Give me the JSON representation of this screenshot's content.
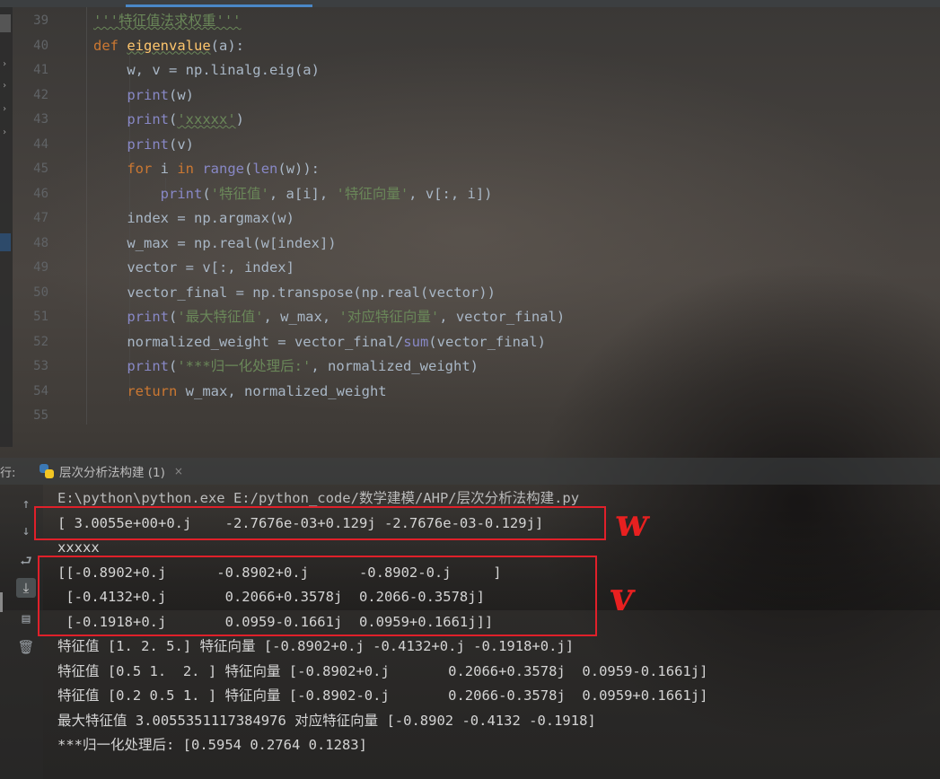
{
  "editor": {
    "lines": [
      {
        "no": "39",
        "segments": [
          {
            "t": "'''特征值法求权重'''",
            "c": "str squig"
          }
        ]
      },
      {
        "no": "40",
        "segments": [
          {
            "t": "def ",
            "c": "kw"
          },
          {
            "t": "eigenvalue",
            "c": "fn squig"
          },
          {
            "t": "(a):",
            "c": ""
          }
        ]
      },
      {
        "no": "41",
        "segments": [
          {
            "t": "    w, v = np.linalg.eig(a)",
            "c": ""
          }
        ]
      },
      {
        "no": "42",
        "segments": [
          {
            "t": "    ",
            "c": ""
          },
          {
            "t": "print",
            "c": "bi"
          },
          {
            "t": "(w)",
            "c": ""
          }
        ]
      },
      {
        "no": "43",
        "segments": [
          {
            "t": "    ",
            "c": ""
          },
          {
            "t": "print",
            "c": "bi"
          },
          {
            "t": "(",
            "c": ""
          },
          {
            "t": "'xxxxx'",
            "c": "str squig"
          },
          {
            "t": ")",
            "c": ""
          }
        ]
      },
      {
        "no": "44",
        "segments": [
          {
            "t": "    ",
            "c": ""
          },
          {
            "t": "print",
            "c": "bi"
          },
          {
            "t": "(v)",
            "c": ""
          }
        ]
      },
      {
        "no": "45",
        "segments": [
          {
            "t": "    ",
            "c": ""
          },
          {
            "t": "for",
            "c": "kw"
          },
          {
            "t": " i ",
            "c": ""
          },
          {
            "t": "in",
            "c": "kw"
          },
          {
            "t": " ",
            "c": ""
          },
          {
            "t": "range",
            "c": "bi"
          },
          {
            "t": "(",
            "c": ""
          },
          {
            "t": "len",
            "c": "bi"
          },
          {
            "t": "(w)):",
            "c": ""
          }
        ]
      },
      {
        "no": "46",
        "segments": [
          {
            "t": "        ",
            "c": ""
          },
          {
            "t": "print",
            "c": "bi"
          },
          {
            "t": "(",
            "c": ""
          },
          {
            "t": "'特征值'",
            "c": "str"
          },
          {
            "t": ", a[i], ",
            "c": ""
          },
          {
            "t": "'特征向量'",
            "c": "str"
          },
          {
            "t": ", v[:, i])",
            "c": ""
          }
        ]
      },
      {
        "no": "47",
        "segments": [
          {
            "t": "    index = np.argmax(w)",
            "c": ""
          }
        ]
      },
      {
        "no": "48",
        "segments": [
          {
            "t": "    w_max = np.real(w[index])",
            "c": ""
          }
        ]
      },
      {
        "no": "49",
        "segments": [
          {
            "t": "    vector = v[:, index]",
            "c": ""
          }
        ]
      },
      {
        "no": "50",
        "segments": [
          {
            "t": "    vector_final = np.transpose(np.real(vector))",
            "c": ""
          }
        ]
      },
      {
        "no": "51",
        "segments": [
          {
            "t": "    ",
            "c": ""
          },
          {
            "t": "print",
            "c": "bi"
          },
          {
            "t": "(",
            "c": ""
          },
          {
            "t": "'最大特征值'",
            "c": "str"
          },
          {
            "t": ", w_max, ",
            "c": ""
          },
          {
            "t": "'对应特征向量'",
            "c": "str"
          },
          {
            "t": ", vector_final)",
            "c": ""
          }
        ]
      },
      {
        "no": "52",
        "segments": [
          {
            "t": "    normalized_weight = vector_final/",
            "c": ""
          },
          {
            "t": "sum",
            "c": "bi"
          },
          {
            "t": "(vector_final)",
            "c": ""
          }
        ]
      },
      {
        "no": "53",
        "segments": [
          {
            "t": "    ",
            "c": ""
          },
          {
            "t": "print",
            "c": "bi"
          },
          {
            "t": "(",
            "c": ""
          },
          {
            "t": "'***归一化处理后:'",
            "c": "str"
          },
          {
            "t": ", normalized_weight)",
            "c": ""
          }
        ]
      },
      {
        "no": "54",
        "segments": [
          {
            "t": "    ",
            "c": ""
          },
          {
            "t": "return",
            "c": "kw"
          },
          {
            "t": " w_max, normalized_weight",
            "c": ""
          }
        ]
      },
      {
        "no": "55",
        "segments": []
      }
    ]
  },
  "run_panel": {
    "label": "行:",
    "tab_title": "层次分析法构建 (1)",
    "tab_close": "×",
    "output": [
      "E:\\python\\python.exe E:/python_code/数学建模/AHP/层次分析法构建.py",
      "[ 3.0055e+00+0.j    -2.7676e-03+0.129j -2.7676e-03-0.129j]",
      "xxxxx",
      "[[-0.8902+0.j      -0.8902+0.j      -0.8902-0.j     ]",
      " [-0.4132+0.j       0.2066+0.3578j  0.2066-0.3578j]",
      " [-0.1918+0.j       0.0959-0.1661j  0.0959+0.1661j]]",
      "特征值 [1. 2. 5.] 特征向量 [-0.8902+0.j -0.4132+0.j -0.1918+0.j]",
      "特征值 [0.5 1.  2. ] 特征向量 [-0.8902+0.j       0.2066+0.3578j  0.0959-0.1661j]",
      "特征值 [0.2 0.5 1. ] 特征向量 [-0.8902-0.j       0.2066-0.3578j  0.0959+0.1661j]",
      "最大特征值 3.0055351117384976 对应特征向量 [-0.8902 -0.4132 -0.1918]",
      "***归一化处理后: [0.5954 0.2764 0.1283]"
    ]
  },
  "annotations": {
    "w_label": "w",
    "v_label": "v"
  },
  "colors": {
    "annotation_red": "#e0202a",
    "keyword": "#cc7832",
    "function": "#ffc66d",
    "string": "#6a8759",
    "builtin": "#8888c6"
  }
}
